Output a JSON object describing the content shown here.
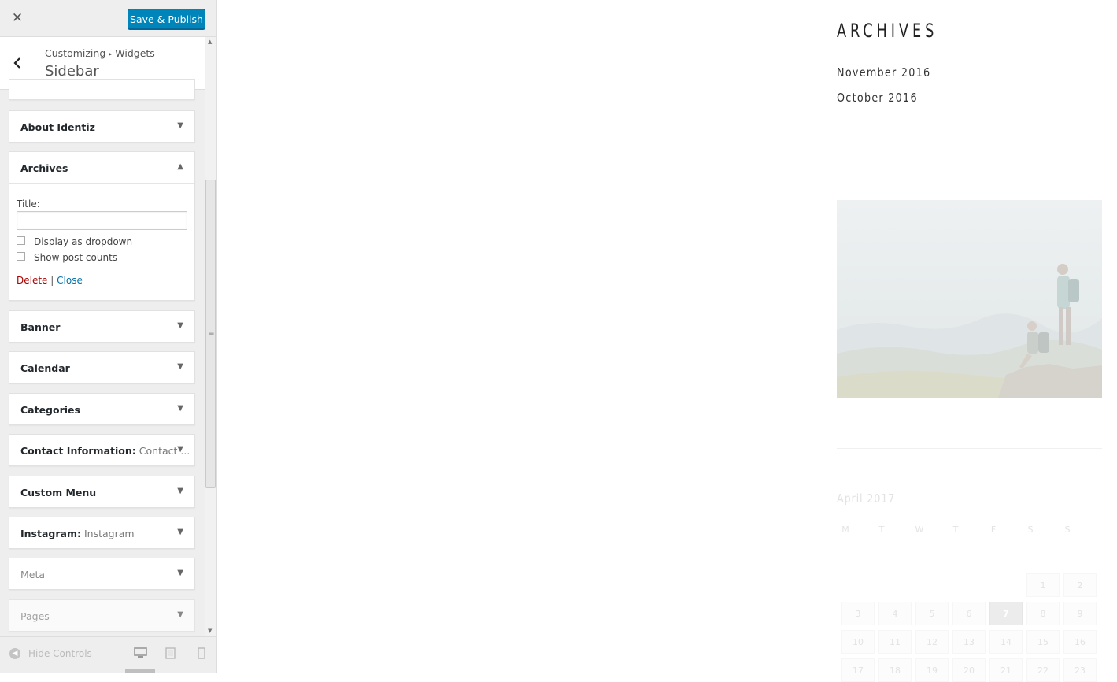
{
  "topbar": {
    "close_glyph": "✕",
    "publish_label": "Save & Publish"
  },
  "section": {
    "breadcrumb_root": "Customizing",
    "breadcrumb_sep": "▸",
    "breadcrumb_child": "Widgets",
    "title": "Sidebar"
  },
  "widgets": [
    {
      "title": "About Identiz",
      "sub": ""
    },
    {
      "title": "Archives",
      "sub": ""
    },
    {
      "title": "Banner",
      "sub": ""
    },
    {
      "title": "Calendar",
      "sub": ""
    },
    {
      "title": "Categories",
      "sub": ""
    },
    {
      "title": "Contact Information:",
      "sub": "Contact ..."
    },
    {
      "title": "Custom Menu",
      "sub": ""
    },
    {
      "title": "Instagram:",
      "sub": "Instagram"
    },
    {
      "title": "Meta",
      "sub": ""
    },
    {
      "title": "Pages",
      "sub": ""
    }
  ],
  "archives_form": {
    "title_label": "Title:",
    "title_value": "",
    "dropdown_label": "Display as dropdown",
    "counts_label": "Show post counts",
    "delete_label": "Delete",
    "separator": "|",
    "close_label": "Close"
  },
  "footer": {
    "hide_label": "Hide Controls"
  },
  "preview": {
    "archives_heading": "ARCHIVES",
    "archive_links": [
      "November 2016",
      "October 2016"
    ],
    "calendar": {
      "title": "April 2017",
      "weekdays": [
        "M",
        "T",
        "W",
        "T",
        "F",
        "S",
        "S"
      ],
      "rows": [
        [
          "",
          "",
          "",
          "",
          "",
          "1",
          "2"
        ],
        [
          "3",
          "4",
          "5",
          "6",
          "7",
          "8",
          "9"
        ],
        [
          "10",
          "11",
          "12",
          "13",
          "14",
          "15",
          "16"
        ],
        [
          "17",
          "18",
          "19",
          "20",
          "21",
          "22",
          "23"
        ]
      ],
      "today": "7"
    }
  },
  "colors": {
    "primary_button": "#0085ba",
    "delete_link": "#aa0000",
    "close_link": "#0073aa"
  },
  "icons": [
    "close-icon",
    "back-chevron-icon",
    "caret-down-icon",
    "caret-up-icon",
    "hide-controls-icon",
    "desktop-icon",
    "tablet-icon",
    "mobile-icon"
  ]
}
